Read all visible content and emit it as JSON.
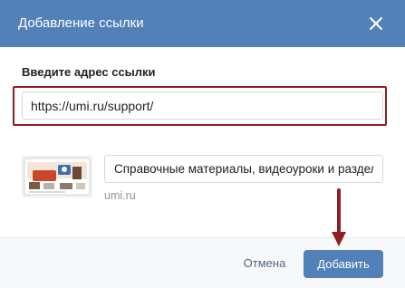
{
  "dialog": {
    "title": "Добавление ссылки",
    "close_icon": "close-icon"
  },
  "link_form": {
    "label": "Введите адрес ссылки",
    "url_value": "https://umi.ru/support/"
  },
  "preview": {
    "thumbnail_icon": "site-preview-thumbnail",
    "title_value": "Справочные материалы, видеоуроки и раздел",
    "domain": "umi.ru"
  },
  "footer": {
    "cancel_label": "Отмена",
    "add_label": "Добавить"
  },
  "colors": {
    "header_bg": "#5181b8",
    "primary_button": "#5181b8",
    "highlight": "#8e1f1f"
  },
  "annotation": {
    "arrow_icon": "arrow-down-icon"
  }
}
